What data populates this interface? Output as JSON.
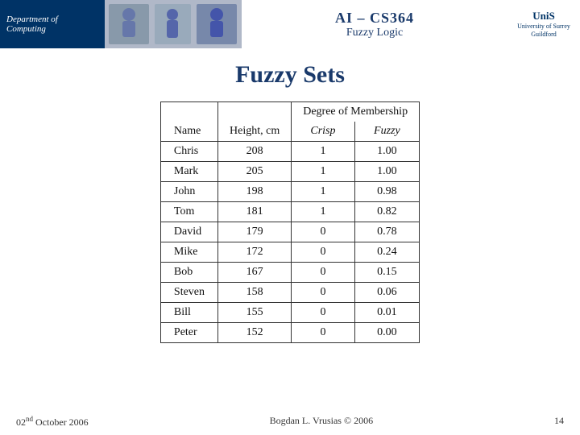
{
  "header": {
    "dept": "Department of Computing",
    "course": "AI – CS364",
    "subtitle": "Fuzzy Logic",
    "uni_name": "UniS",
    "uni_sub": "University of Surrey\nGuildford"
  },
  "page": {
    "title": "Fuzzy Sets"
  },
  "table": {
    "col_name": "Name",
    "col_height": "Height, cm",
    "col_dom": "Degree of Membership",
    "col_crisp": "Crisp",
    "col_fuzzy": "Fuzzy",
    "rows": [
      {
        "name": "Chris",
        "height": "208",
        "crisp": "1",
        "fuzzy": "1.00"
      },
      {
        "name": "Mark",
        "height": "205",
        "crisp": "1",
        "fuzzy": "1.00"
      },
      {
        "name": "John",
        "height": "198",
        "crisp": "1",
        "fuzzy": "0.98"
      },
      {
        "name": "Tom",
        "height": "181",
        "crisp": "1",
        "fuzzy": "0.82"
      },
      {
        "name": "David",
        "height": "179",
        "crisp": "0",
        "fuzzy": "0.78"
      },
      {
        "name": "Mike",
        "height": "172",
        "crisp": "0",
        "fuzzy": "0.24"
      },
      {
        "name": "Bob",
        "height": "167",
        "crisp": "0",
        "fuzzy": "0.15"
      },
      {
        "name": "Steven",
        "height": "158",
        "crisp": "0",
        "fuzzy": "0.06"
      },
      {
        "name": "Bill",
        "height": "155",
        "crisp": "0",
        "fuzzy": "0.01"
      },
      {
        "name": "Peter",
        "height": "152",
        "crisp": "0",
        "fuzzy": "0.00"
      }
    ]
  },
  "footer": {
    "date": "02nd October 2006",
    "author": "Bogdan L. Vrusias © 2006",
    "page": "14"
  }
}
